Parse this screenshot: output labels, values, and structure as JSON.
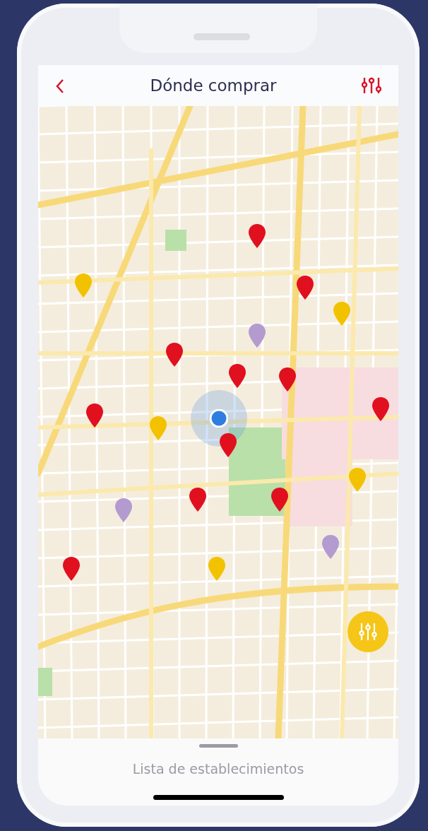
{
  "header": {
    "title": "Dónde comprar"
  },
  "map": {
    "pins": [
      {
        "color": "#e0101e"
      },
      {
        "color": "#e0101e"
      },
      {
        "color": "#e0101e"
      },
      {
        "color": "#e0101e"
      },
      {
        "color": "#e0101e"
      },
      {
        "color": "#e0101e"
      },
      {
        "color": "#e0101e"
      },
      {
        "color": "#e0101e"
      },
      {
        "color": "#e0101e"
      },
      {
        "color": "#e0101e"
      },
      {
        "color": "#e0101e"
      },
      {
        "color": "#f2c200"
      },
      {
        "color": "#f2c200"
      },
      {
        "color": "#f2c200"
      },
      {
        "color": "#f2c200"
      },
      {
        "color": "#f2c200"
      },
      {
        "color": "#b39bd0"
      },
      {
        "color": "#b39bd0"
      },
      {
        "color": "#b39bd0"
      }
    ]
  },
  "bottom_sheet": {
    "label": "Lista de establecimientos"
  }
}
